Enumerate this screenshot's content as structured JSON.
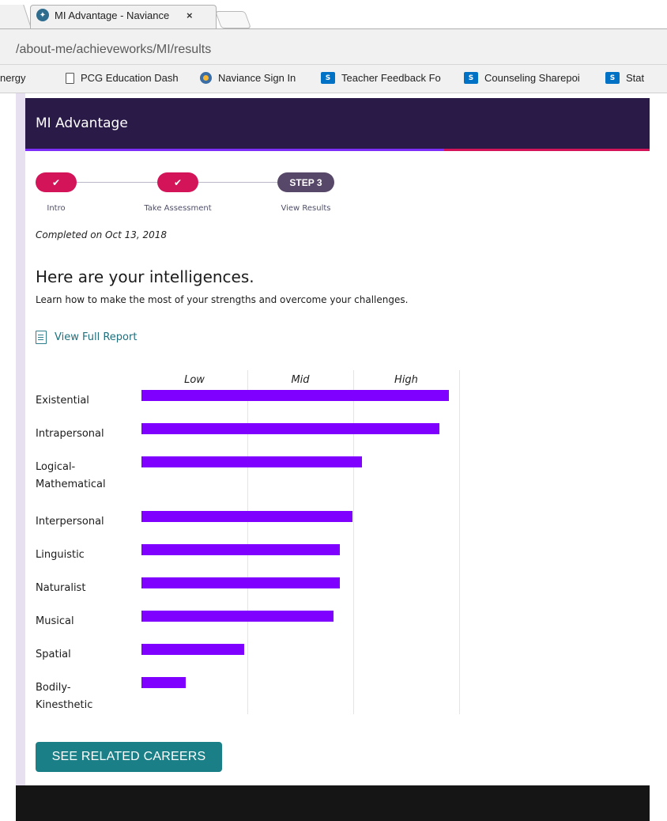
{
  "browser": {
    "tab_title": "MI Advantage - Naviance",
    "tab_close": "×",
    "address": "/about-me/achieveworks/MI/results",
    "bookmarks": [
      {
        "label": "nergy",
        "icon": "none"
      },
      {
        "label": "PCG Education Dash",
        "icon": "document-icon"
      },
      {
        "label": "Naviance Sign In",
        "icon": "naviance-icon"
      },
      {
        "label": "Teacher Feedback Fo",
        "icon": "sharepoint-icon"
      },
      {
        "label": "Counseling Sharepoi",
        "icon": "sharepoint-icon"
      },
      {
        "label": "Stat",
        "icon": "sharepoint-icon"
      }
    ]
  },
  "app": {
    "title": "MI Advantage",
    "colors": {
      "header": "#2a1a47",
      "accent": "#7b2ff7",
      "accent2": "#d31459",
      "bar": "#8000ff",
      "button": "#1a7f86"
    }
  },
  "stepper": {
    "steps": [
      {
        "label": "Intro",
        "status": "done",
        "icon": "check-icon",
        "glyph": "✔"
      },
      {
        "label": "Take Assessment",
        "status": "done",
        "icon": "check-icon",
        "glyph": "✔"
      },
      {
        "label": "View Results",
        "status": "current",
        "pill": "STEP 3"
      }
    ]
  },
  "results": {
    "completed": "Completed on Oct 13, 2018",
    "heading": "Here are your intelligences.",
    "subheading": "Learn how to make the most of your strengths and overcome your challenges.",
    "report_link": "View Full Report",
    "button": "SEE RELATED CAREERS"
  },
  "chart_data": {
    "type": "bar",
    "orientation": "horizontal",
    "levels": [
      "Low",
      "Mid",
      "High"
    ],
    "xlim": [
      0,
      3
    ],
    "grid": true,
    "categories": [
      [
        "Existential"
      ],
      [
        "Intrapersonal"
      ],
      [
        "Logical-",
        "Mathematical"
      ],
      [
        "Interpersonal"
      ],
      [
        "Linguistic"
      ],
      [
        "Naturalist"
      ],
      [
        "Musical"
      ],
      [
        "Spatial"
      ],
      [
        "Bodily-",
        "Kinesthetic"
      ]
    ],
    "values": [
      2.9,
      2.81,
      2.08,
      1.99,
      1.87,
      1.87,
      1.81,
      0.97,
      0.42
    ]
  }
}
